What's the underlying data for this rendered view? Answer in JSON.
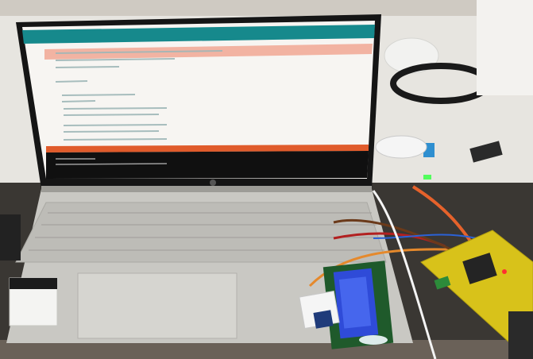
{
  "scene": {
    "description_tag": "photo-laptop-arduino-lcd",
    "colors": {
      "ide_teal": "#16898c",
      "ide_orange": "#e05b2b",
      "lcd_blue": "#2f4bd8",
      "pcb_yellow": "#d8c21a",
      "laptop_silver": "#c9c8c3",
      "table_white": "#e9e7e2"
    },
    "icons": [
      "laptop-icon",
      "arduino-board-icon",
      "lcd-display-icon",
      "servo-motor-icon",
      "sensor-icon",
      "cable-icon"
    ]
  },
  "ide": {
    "code_lines": [
      "  ",
      "  ",
      "  ",
      "  ",
      "  ",
      "  ",
      "  ",
      "  "
    ]
  }
}
